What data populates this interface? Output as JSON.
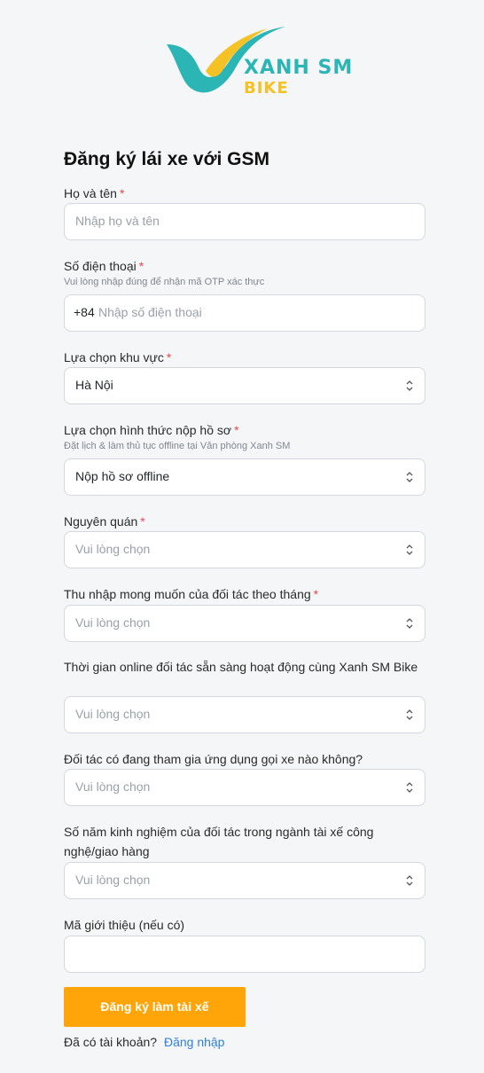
{
  "brand": {
    "line1": "XANH SM",
    "line2": "BIKE"
  },
  "title": "Đăng ký lái xe với GSM",
  "fields": {
    "name": {
      "label": "Họ và tên",
      "placeholder": "Nhập họ và tên"
    },
    "phone": {
      "label": "Số điện thoại",
      "hint": "Vui lòng nhập đúng để nhận mã OTP xác thực",
      "prefix": "+84",
      "placeholder": "Nhập số điện thoại"
    },
    "region": {
      "label": "Lựa chọn khu vực",
      "value": "Hà Nội"
    },
    "submission": {
      "label": "Lựa chọn hình thức nộp hồ sơ",
      "hint": "Đặt lịch & làm thủ tục offline tại Văn phòng Xanh SM",
      "value": "Nộp hồ sơ offline"
    },
    "hometown": {
      "label": "Nguyên quán",
      "placeholder": "Vui lòng chọn"
    },
    "income": {
      "label": "Thu nhập mong muốn của đối tác theo tháng",
      "placeholder": "Vui lòng chọn"
    },
    "online_time": {
      "label": "Thời gian online đối tác sẵn sàng hoạt động cùng Xanh SM Bike",
      "placeholder": "Vui lòng chọn"
    },
    "other_app": {
      "label": "Đối tác có đang tham gia ứng dụng gọi xe nào không?",
      "placeholder": "Vui lòng chọn"
    },
    "experience": {
      "label": "Số năm kinh nghiệm của đối tác trong ngành tài xế công nghệ/giao hàng",
      "placeholder": "Vui lòng chọn"
    },
    "referral": {
      "label": "Mã giới thiệu (nếu có)",
      "value": ""
    }
  },
  "required_mark": "*",
  "submit_label": "Đăng ký làm tài xế",
  "footer": {
    "text": "Đã có tài khoản?",
    "link": "Đăng nhập"
  },
  "colors": {
    "accent": "#ffa50a",
    "link": "#2f7fd6",
    "required": "#e5484d",
    "brand_teal": "#2bb5b5",
    "brand_yellow": "#f5c226"
  }
}
